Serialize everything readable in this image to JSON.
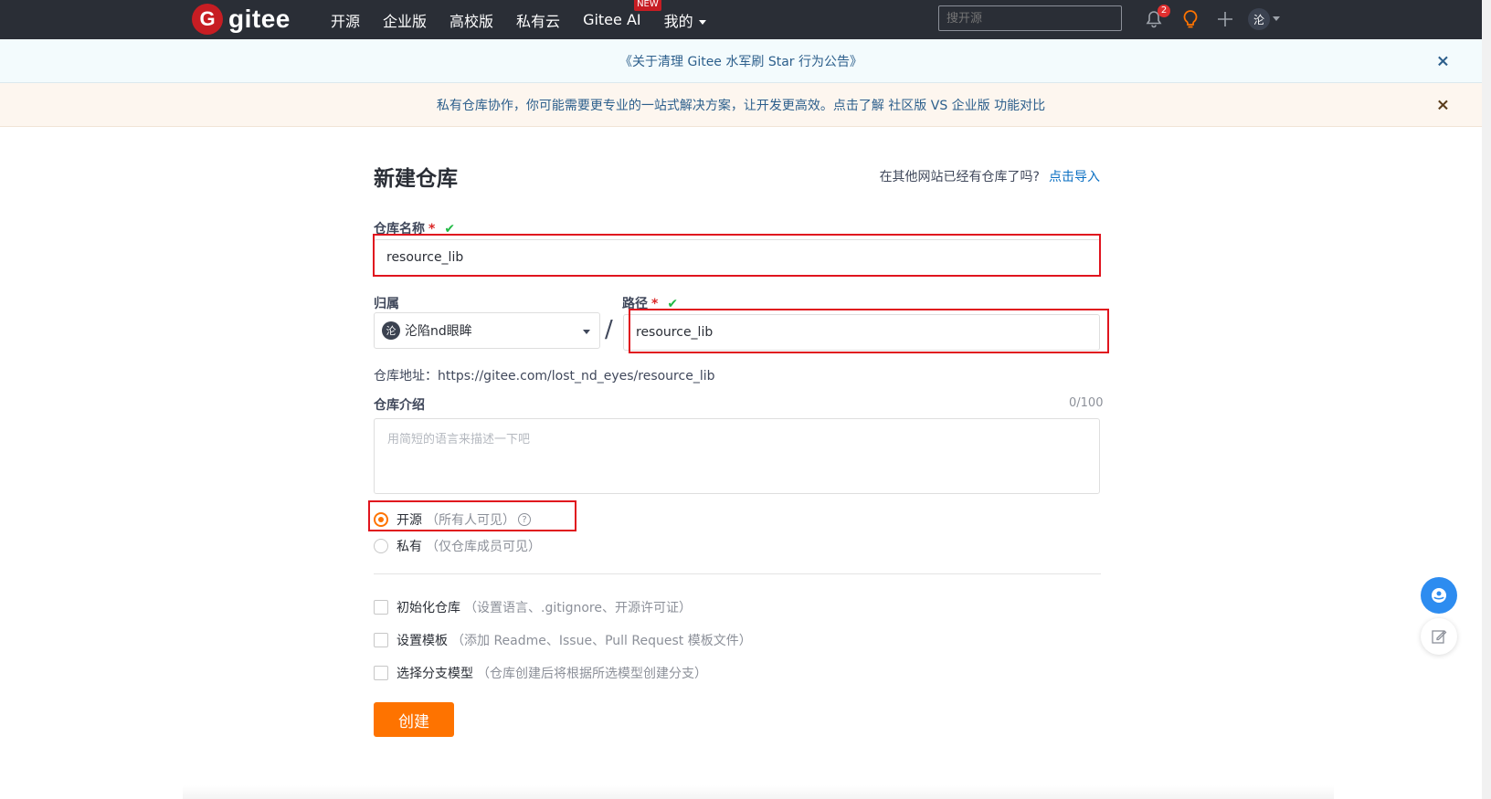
{
  "nav": {
    "logo_mark": "G",
    "logo_text": "gitee",
    "items": [
      {
        "label": "开源"
      },
      {
        "label": "企业版"
      },
      {
        "label": "高校版"
      },
      {
        "label": "私有云"
      },
      {
        "label": "Gitee AI",
        "badge": "NEW"
      },
      {
        "label": "我的"
      }
    ],
    "search_placeholder": "搜开源",
    "notification_count": "2",
    "avatar_initial": "沦"
  },
  "banners": {
    "announcement": "《关于清理 Gitee 水军刷 Star 行为公告》",
    "promo": "私有仓库协作，你可能需要更专业的一站式解决方案，让开发更高效。点击了解 社区版 VS 企业版 功能对比",
    "close_symbol": "×"
  },
  "form": {
    "title": "新建仓库",
    "import_hint": "在其他网站已经有仓库了吗?",
    "import_link": "点击导入",
    "repo_name_label": "仓库名称",
    "repo_name_value": "resource_lib",
    "owner_label": "归属",
    "owner_value": "沦陷nd眼眸",
    "owner_avatar": "沦",
    "path_label": "路径",
    "path_value": "resource_lib",
    "slash": "/",
    "required_mark": "*",
    "valid_mark": "✔",
    "repo_url_label": "仓库地址：",
    "repo_url": "https://gitee.com/lost_nd_eyes/resource_lib",
    "intro_label": "仓库介绍",
    "intro_counter": "0/100",
    "intro_placeholder": "用简短的语言来描述一下吧",
    "visibility": [
      {
        "label": "开源",
        "hint": "（所有人可见）",
        "selected": true
      },
      {
        "label": "私有",
        "hint": "（仅仓库成员可见）",
        "selected": false
      }
    ],
    "options": [
      {
        "label": "初始化仓库",
        "hint": "（设置语言、.gitignore、开源许可证）",
        "checked": false
      },
      {
        "label": "设置模板",
        "hint": "（添加 Readme、Issue、Pull Request 模板文件）",
        "checked": false
      },
      {
        "label": "选择分支模型",
        "hint": "（仓库创建后将根据所选模型创建分支）",
        "checked": false
      }
    ],
    "create_button": "创建"
  },
  "colors": {
    "nav_bg": "#2a2e36",
    "brand_red": "#c71d23",
    "accent_orange": "#fe7300",
    "link_blue": "#0a6fc2",
    "highlight_red": "#e0141e"
  }
}
